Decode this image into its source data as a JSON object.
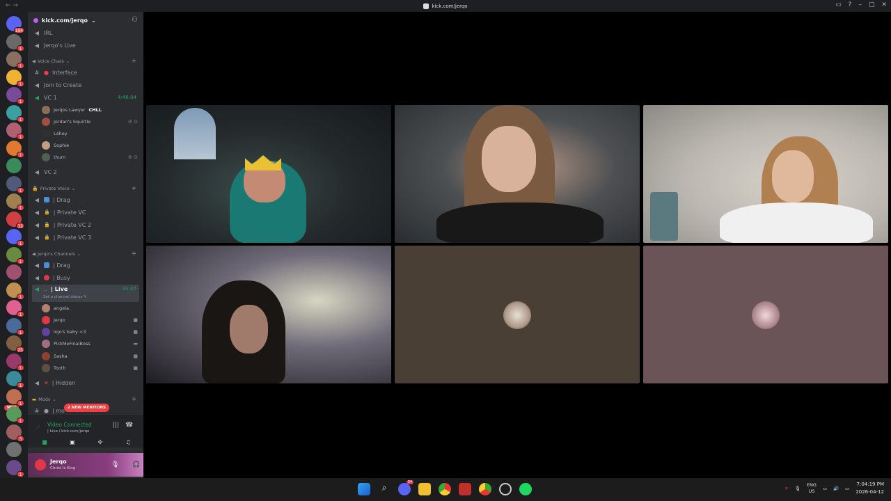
{
  "titlebar": {
    "title": "kick.com/jerqo"
  },
  "guilds": {
    "badges": [
      "184",
      "1",
      "1",
      "1",
      "1",
      "1",
      "1",
      "1",
      "",
      "1",
      "1",
      "12",
      "1",
      "1",
      "",
      "1",
      "1",
      "1",
      "25",
      "1",
      "1",
      "1",
      "1",
      "3",
      "",
      "1"
    ],
    "new_label": "NEW"
  },
  "server": {
    "name": "kick.com/jerqo"
  },
  "channels": {
    "irl": "IRL",
    "jerqos_live": "Jerqo's Live",
    "voice_chats_cat": "Voice Chats",
    "interface": "Interface",
    "join_to_create": "Join to Create",
    "vc1": "VC 1",
    "vc1_time": "4:46:04",
    "vc1_users": [
      {
        "name": "Jerqos Lawyer",
        "tag": "CHLL",
        "color": "#8a6d5a"
      },
      {
        "name": "Jordan's Squirtle",
        "tag": "",
        "color": "#a05040"
      },
      {
        "name": "Lahey",
        "tag": "",
        "color": "#303030"
      },
      {
        "name": "Sophie",
        "tag": "",
        "color": "#c0a080"
      },
      {
        "name": "thum",
        "tag": "",
        "color": "#506050"
      }
    ],
    "vc2": "VC 2",
    "private_voice_cat": "Private Voice",
    "drag": "| Drag",
    "private_vc": "| Private VC",
    "private_vc2": "| Private VC 2",
    "private_vc3": "| Private VC 3",
    "jerqos_channels_cat": "Jerqo's Channels",
    "drag2": "| Drag",
    "busy": "| Busy",
    "live": "| Live",
    "live_time": "31:47",
    "live_status": "Set a channel status",
    "live_users": [
      {
        "name": "angela.",
        "color": "#b08070"
      },
      {
        "name": "Jerqo",
        "color": "#e23747"
      },
      {
        "name": "lojo's baby <3",
        "color": "#6040a0"
      },
      {
        "name": "PickMeFinalBoss",
        "color": "#a07080"
      },
      {
        "name": "Sasha",
        "color": "#904030"
      },
      {
        "name": "Tooth",
        "color": "#605040"
      }
    ],
    "hidden": "| Hidden",
    "mods_cat": "Mods",
    "mod_channel": "| mo",
    "mentions": "2 NEW MENTIONS"
  },
  "voice_panel": {
    "title": "Video Connected",
    "subtitle": "| Live / kick.com/jerqo"
  },
  "user_panel": {
    "name": "Jerqo",
    "status": "Christ Is King"
  },
  "taskbar": {
    "discord_badge": "34",
    "lang": "ENG",
    "region": "US",
    "time": "7:04:19 PM",
    "date": "2026-04-12"
  }
}
